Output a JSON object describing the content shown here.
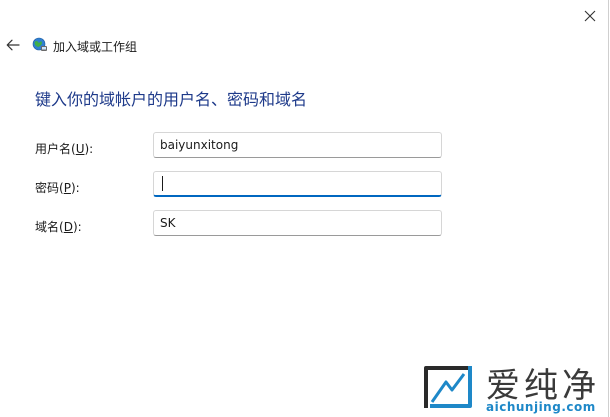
{
  "dialog": {
    "title": "加入域或工作组",
    "heading": "键入你的域帐户的用户名、密码和域名"
  },
  "fields": {
    "username": {
      "label_pre": "用户名(",
      "accesskey": "U",
      "label_post": "):",
      "value": "baiyunxitong"
    },
    "password": {
      "label_pre": "密码(",
      "accesskey": "P",
      "label_post": "):",
      "value": ""
    },
    "domain": {
      "label_pre": "域名(",
      "accesskey": "D",
      "label_post": "):",
      "value": "SK"
    }
  },
  "watermark": {
    "brand": "爱纯净",
    "url": "aichunjing.com"
  },
  "icons": {
    "back": "back-arrow-icon",
    "close": "close-icon",
    "app": "network-globe-icon"
  },
  "colors": {
    "accent": "#0067c0",
    "heading": "#1e3a8a"
  }
}
